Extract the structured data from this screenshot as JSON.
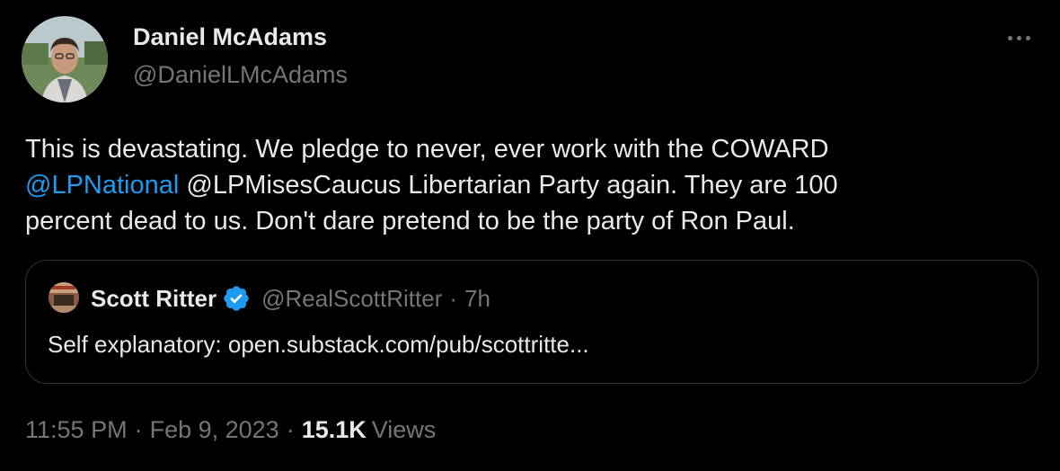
{
  "author": {
    "name": "Daniel McAdams",
    "handle": "@DanielLMcAdams"
  },
  "tweet": {
    "text_line1": "This is devastating. We pledge to never, ever work with the COWARD",
    "mention_1": "@LPNational",
    "mention_2": "@LPMisesCaucus",
    "text_line2_rest": " Libertarian Party again. They are 100",
    "text_line3": "percent dead to us. Don't dare pretend to be the party of Ron Paul."
  },
  "quote": {
    "name": "Scott Ritter",
    "handle": "@RealScottRitter",
    "separator": "·",
    "time": "7h",
    "text": "Self explanatory: open.substack.com/pub/scottritte..."
  },
  "meta": {
    "time": "11:55 PM",
    "separator": "·",
    "date": "Feb 9, 2023",
    "views_count": "15.1K",
    "views_label": "Views"
  },
  "colors": {
    "background": "#000000",
    "text": "#e7e9ea",
    "secondary": "#71767b",
    "accent": "#1d9bf0",
    "border": "#2f3336"
  },
  "icons": {
    "more": "more-options-icon",
    "verified": "verified-badge-icon"
  }
}
